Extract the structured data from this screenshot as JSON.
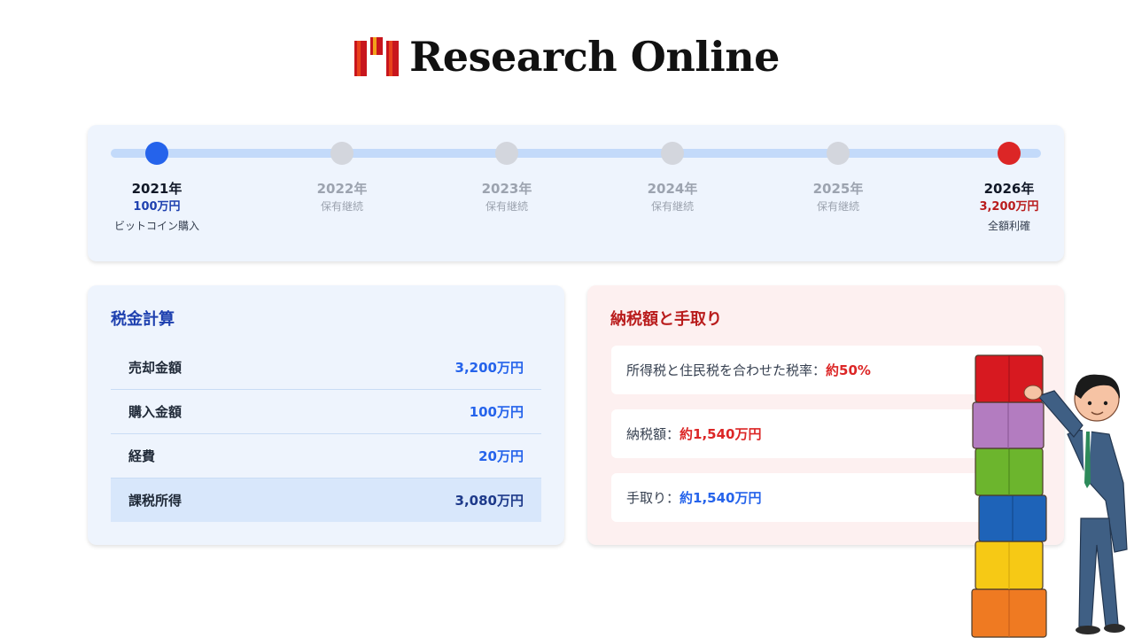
{
  "brand": {
    "name": "Research Online"
  },
  "timeline": [
    {
      "year": "2021年",
      "amount": "100万円",
      "note": "ビットコイン購入",
      "state": "start"
    },
    {
      "year": "2022年",
      "amount": "",
      "note": "保有継続",
      "state": "hold"
    },
    {
      "year": "2023年",
      "amount": "",
      "note": "保有継続",
      "state": "hold"
    },
    {
      "year": "2024年",
      "amount": "",
      "note": "保有継続",
      "state": "hold"
    },
    {
      "year": "2025年",
      "amount": "",
      "note": "保有継続",
      "state": "hold"
    },
    {
      "year": "2026年",
      "amount": "3,200万円",
      "note": "全額利確",
      "state": "end"
    }
  ],
  "tax": {
    "title": "税金計算",
    "rows": [
      {
        "label": "売却金額",
        "value": "3,200万円"
      },
      {
        "label": "購入金額",
        "value": "100万円"
      },
      {
        "label": "経費",
        "value": "20万円"
      },
      {
        "label": "課税所得",
        "value": "3,080万円"
      }
    ]
  },
  "net": {
    "title": "納税額と手取り",
    "items": [
      {
        "label": "所得税と住民税を合わせた税率：",
        "value": "約50%"
      },
      {
        "label": "納税額：",
        "value": "約1,540万円"
      },
      {
        "label": "手取り：",
        "value": "約1,540万円"
      }
    ]
  },
  "colors": {
    "primary_blue": "#2563eb",
    "accent_red": "#dc2626",
    "brand_red": "#c8161d"
  },
  "illustration": {
    "icon": "businessman-stacking-boxes-illustration"
  }
}
